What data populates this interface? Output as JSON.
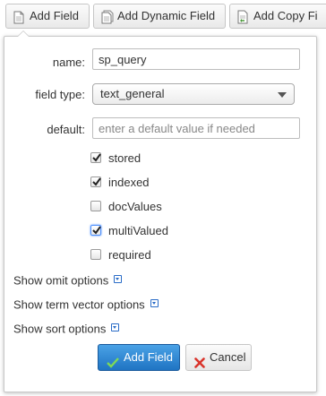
{
  "toolbar": {
    "add_field_label": "Add Field",
    "add_dynamic_field_label": "Add Dynamic Field",
    "add_copy_field_label": "Add Copy Fi"
  },
  "form": {
    "name_label": "name:",
    "name_value": "sp_query",
    "field_type_label": "field type:",
    "field_type_value": "text_general",
    "default_label": "default:",
    "default_placeholder": "enter a default value if needed",
    "checkboxes": [
      {
        "label": "stored",
        "checked": true
      },
      {
        "label": "indexed",
        "checked": true
      },
      {
        "label": "docValues",
        "checked": false
      },
      {
        "label": "multiValued",
        "checked": true
      },
      {
        "label": "required",
        "checked": false
      }
    ],
    "options": [
      {
        "label": "Show omit options"
      },
      {
        "label": "Show term vector options"
      },
      {
        "label": "Show sort options"
      }
    ],
    "submit_label": "Add Field",
    "cancel_label": "Cancel"
  },
  "colors": {
    "primary_button": "#2a84d2",
    "cancel_icon": "#d9342b",
    "check_icon": "#7ed957",
    "expand_icon": "#2a6cc7"
  },
  "icons": {
    "add_field": "document-icon",
    "add_dynamic_field": "stacked-documents-icon",
    "add_copy_field": "copy-document-icon",
    "submit": "check-icon",
    "cancel": "x-icon",
    "expand": "expand-down-icon"
  }
}
